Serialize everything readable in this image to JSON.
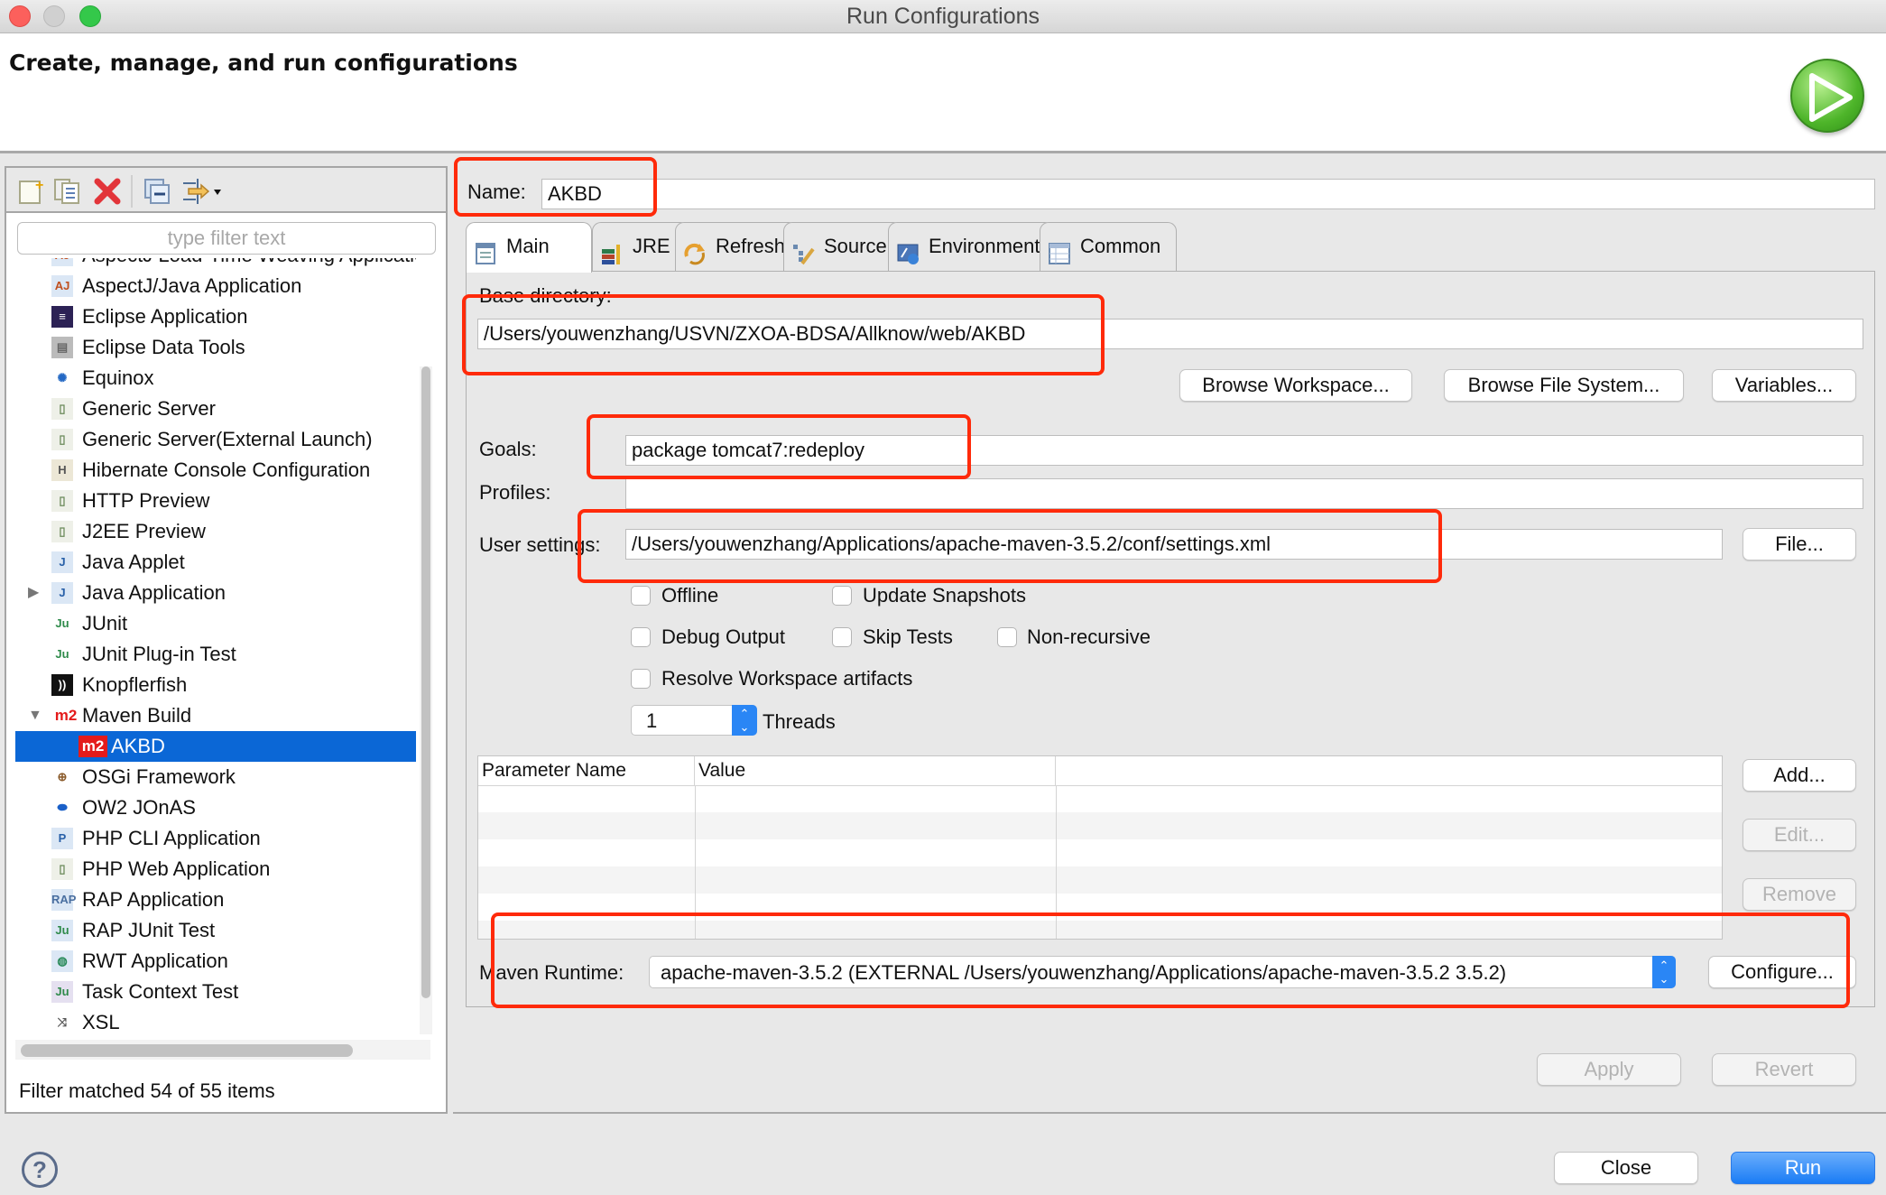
{
  "window": {
    "title": "Run Configurations",
    "header_title": "Create, manage, and run configurations"
  },
  "left_panel": {
    "toolbar": [
      "new-configuration-icon",
      "duplicate-icon",
      "delete-icon",
      "collapse-all-icon",
      "filter-icon"
    ],
    "filter_placeholder": "type filter text",
    "tree": [
      {
        "label": "AspectJ Load-Time Weaving Application",
        "icon": "aspectj-ltw-icon",
        "partial": true
      },
      {
        "label": "AspectJ/Java Application",
        "icon": "aspectj-icon"
      },
      {
        "label": "Eclipse Application",
        "icon": "eclipse-icon"
      },
      {
        "label": "Eclipse Data Tools",
        "icon": "database-icon"
      },
      {
        "label": "Equinox",
        "icon": "equinox-icon"
      },
      {
        "label": "Generic Server",
        "icon": "server-icon"
      },
      {
        "label": "Generic Server(External Launch)",
        "icon": "server-icon"
      },
      {
        "label": "Hibernate Console Configuration",
        "icon": "hibernate-icon"
      },
      {
        "label": "HTTP Preview",
        "icon": "server-icon"
      },
      {
        "label": "J2EE Preview",
        "icon": "server-icon"
      },
      {
        "label": "Java Applet",
        "icon": "applet-icon"
      },
      {
        "label": "Java Application",
        "icon": "java-app-icon",
        "expandable": true,
        "expanded": false
      },
      {
        "label": "JUnit",
        "icon": "junit-icon"
      },
      {
        "label": "JUnit Plug-in Test",
        "icon": "junit-plugin-icon"
      },
      {
        "label": "Knopflerfish",
        "icon": "knopflerfish-icon"
      },
      {
        "label": "Maven Build",
        "icon": "m2-icon",
        "expandable": true,
        "expanded": true
      },
      {
        "label": "AKBD",
        "icon": "m2-icon",
        "child": true,
        "selected": true
      },
      {
        "label": "OSGi Framework",
        "icon": "osgi-icon"
      },
      {
        "label": "OW2 JOnAS",
        "icon": "jonas-icon"
      },
      {
        "label": "PHP CLI Application",
        "icon": "php-icon"
      },
      {
        "label": "PHP Web Application",
        "icon": "server-icon"
      },
      {
        "label": "RAP Application",
        "icon": "rap-icon"
      },
      {
        "label": "RAP JUnit Test",
        "icon": "rap-junit-icon"
      },
      {
        "label": "RWT Application",
        "icon": "rwt-icon"
      },
      {
        "label": "Task Context Test",
        "icon": "task-junit-icon"
      },
      {
        "label": "XSL",
        "icon": "xsl-icon"
      }
    ],
    "status": "Filter matched 54 of 55 items"
  },
  "config": {
    "name_label": "Name:",
    "name_value": "AKBD",
    "tabs": [
      {
        "label": "Main",
        "icon": "main-tab-icon",
        "active": true
      },
      {
        "label": "JRE",
        "icon": "jre-icon"
      },
      {
        "label": "Refresh",
        "icon": "refresh-icon"
      },
      {
        "label": "Source",
        "icon": "source-icon"
      },
      {
        "label": "Environment",
        "icon": "environment-icon"
      },
      {
        "label": "Common",
        "icon": "common-icon"
      }
    ],
    "base_dir_label": "Base directory:",
    "base_dir_value": "/Users/youwenzhang/USVN/ZXOA-BDSA/Allknow/web/AKBD",
    "browse_workspace": "Browse Workspace...",
    "browse_fs": "Browse File System...",
    "variables": "Variables...",
    "goals_label": "Goals:",
    "goals_value": "package tomcat7:redeploy",
    "profiles_label": "Profiles:",
    "profiles_value": "",
    "user_settings_label": "User settings:",
    "user_settings_value": "/Users/youwenzhang/Applications/apache-maven-3.5.2/conf/settings.xml",
    "file_button": "File...",
    "checkboxes": {
      "offline": {
        "label": "Offline",
        "checked": false
      },
      "update_snapshots": {
        "label": "Update Snapshots",
        "checked": false
      },
      "debug_output": {
        "label": "Debug Output",
        "checked": false
      },
      "skip_tests": {
        "label": "Skip Tests",
        "checked": false
      },
      "non_recursive": {
        "label": "Non-recursive",
        "checked": false
      },
      "resolve_workspace": {
        "label": "Resolve Workspace artifacts",
        "checked": false
      }
    },
    "threads_value": "1",
    "threads_label": "Threads",
    "param_table": {
      "columns": [
        "Parameter Name",
        "Value"
      ],
      "rows": []
    },
    "add_button": "Add...",
    "edit_button": "Edit...",
    "remove_button": "Remove",
    "maven_runtime_label": "Maven Runtime:",
    "maven_runtime_value": "apache-maven-3.5.2 (EXTERNAL /Users/youwenzhang/Applications/apache-maven-3.5.2 3.5.2)",
    "configure_button": "Configure...",
    "apply_button": "Apply",
    "revert_button": "Revert"
  },
  "footer": {
    "close_button": "Close",
    "run_button": "Run"
  },
  "colors": {
    "accent": "#0b67d6",
    "annotation_red": "#ff2a0a",
    "run_button": "#1a7cf5"
  }
}
